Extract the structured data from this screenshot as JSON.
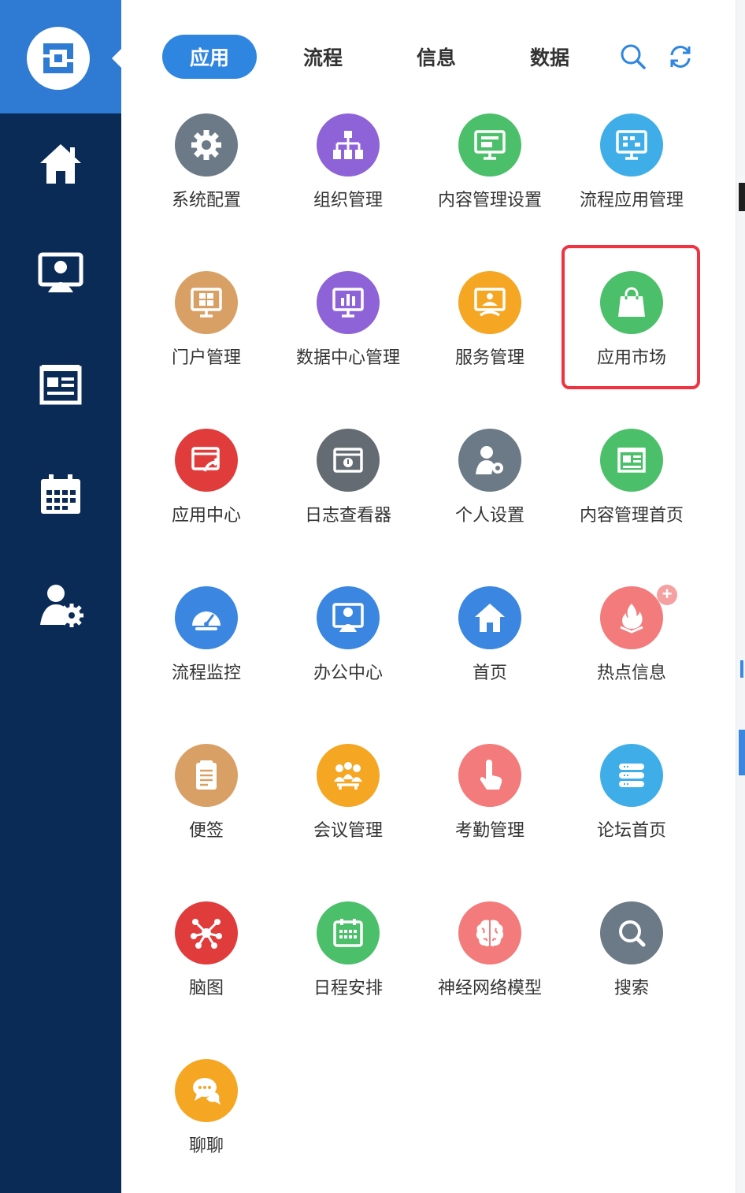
{
  "tabs": [
    {
      "label": "应用",
      "active": true
    },
    {
      "label": "流程",
      "active": false
    },
    {
      "label": "信息",
      "active": false
    },
    {
      "label": "数据",
      "active": false
    }
  ],
  "toolbar_icons": [
    "search-icon",
    "refresh-icon"
  ],
  "sidebar": {
    "items": [
      "home-icon",
      "office-icon",
      "news-icon",
      "calendar-icon",
      "user-settings-icon"
    ]
  },
  "colors": {
    "sidebar": "#0b2b57",
    "accent": "#2f86e0",
    "highlight": "#ef3340"
  },
  "apps": [
    {
      "label": "系统配置",
      "icon": "gear-icon",
      "color": "#6b7a86"
    },
    {
      "label": "组织管理",
      "icon": "org-chart-icon",
      "color": "#8e63d8"
    },
    {
      "label": "内容管理设置",
      "icon": "monitor-icon",
      "color": "#4cbf6a"
    },
    {
      "label": "流程应用管理",
      "icon": "flow-monitor-icon",
      "color": "#3faee8"
    },
    {
      "label": "门户管理",
      "icon": "portal-icon",
      "color": "#d9a066"
    },
    {
      "label": "数据中心管理",
      "icon": "bar-chart-icon",
      "color": "#8e63d8"
    },
    {
      "label": "服务管理",
      "icon": "service-icon",
      "color": "#f5a623"
    },
    {
      "label": "应用市场",
      "icon": "shopping-bag-icon",
      "color": "#4cbf6a"
    },
    {
      "label": "应用中心",
      "icon": "app-center-icon",
      "color": "#e03c3c"
    },
    {
      "label": "日志查看器",
      "icon": "log-viewer-icon",
      "color": "#646b72"
    },
    {
      "label": "个人设置",
      "icon": "person-gear-icon",
      "color": "#6b7a86"
    },
    {
      "label": "内容管理首页",
      "icon": "news-icon",
      "color": "#4cbf6a"
    },
    {
      "label": "流程监控",
      "icon": "gauge-icon",
      "color": "#3a86e0"
    },
    {
      "label": "办公中心",
      "icon": "office-icon",
      "color": "#3a86e0"
    },
    {
      "label": "首页",
      "icon": "home-icon",
      "color": "#3a86e0"
    },
    {
      "label": "热点信息",
      "icon": "flame-icon",
      "color": "#f37b7b",
      "badge": "+"
    },
    {
      "label": "便签",
      "icon": "note-icon",
      "color": "#d9a066"
    },
    {
      "label": "会议管理",
      "icon": "meeting-icon",
      "color": "#f5a623"
    },
    {
      "label": "考勤管理",
      "icon": "touch-icon",
      "color": "#f37b7b"
    },
    {
      "label": "论坛首页",
      "icon": "forum-icon",
      "color": "#3faee8"
    },
    {
      "label": "脑图",
      "icon": "mind-map-icon",
      "color": "#e03c3c"
    },
    {
      "label": "日程安排",
      "icon": "calendar-icon",
      "color": "#4cbf6a"
    },
    {
      "label": "神经网络模型",
      "icon": "brain-icon",
      "color": "#f37b7b"
    },
    {
      "label": "搜索",
      "icon": "search-icon",
      "color": "#6b7a86"
    },
    {
      "label": "聊聊",
      "icon": "chat-icon",
      "color": "#f5a623"
    }
  ],
  "highlighted_app": "应用市场"
}
